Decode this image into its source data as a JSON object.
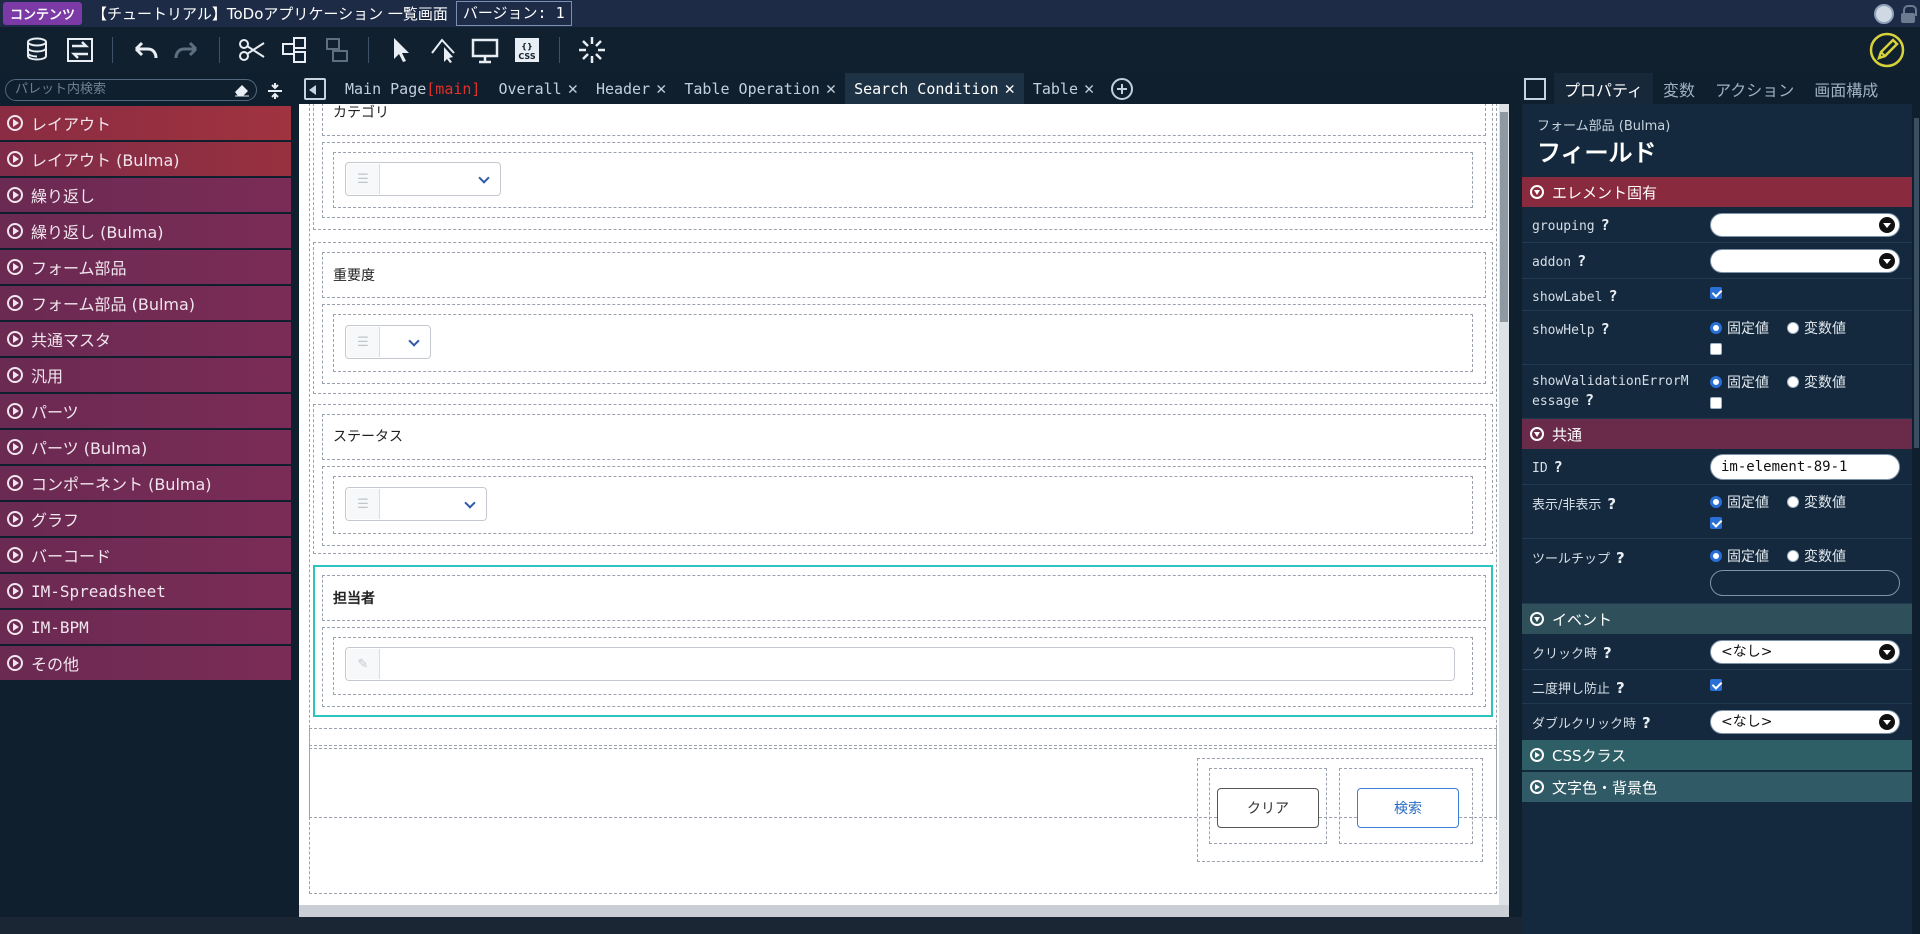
{
  "titlebar": {
    "badge": "コンテンツ",
    "title": "【チュートリアル】ToDoアプリケーション 一覧画面",
    "version": "バージョン: 1"
  },
  "palette": {
    "search_placeholder": "パレット内検索",
    "items": [
      "レイアウト",
      "レイアウト (Bulma)",
      "繰り返し",
      "繰り返し (Bulma)",
      "フォーム部品",
      "フォーム部品 (Bulma)",
      "共通マスタ",
      "汎用",
      "パーツ",
      "パーツ (Bulma)",
      "コンポーネント (Bulma)",
      "グラフ",
      "バーコード",
      "IM-Spreadsheet",
      "IM-BPM",
      "その他"
    ]
  },
  "tabs": {
    "main_label": "Main Page",
    "main_suffix": "[main]",
    "items": [
      "Overall",
      "Header",
      "Table Operation",
      "Search Condition",
      "Table"
    ],
    "active": "Search Condition",
    "close": "✕"
  },
  "canvas": {
    "sections": {
      "category": "カテゴリ",
      "priority": "重要度",
      "status": "ステータス",
      "assignee": "担当者"
    },
    "buttons": {
      "clear": "クリア",
      "search": "検索"
    }
  },
  "properties": {
    "tabs": [
      "プロパティ",
      "変数",
      "アクション",
      "画面構成"
    ],
    "subtitle": "フォーム部品 (Bulma)",
    "title": "フィールド",
    "section_element": "エレメント固有",
    "section_common": "共通",
    "section_event": "イベント",
    "section_css": "CSSクラス",
    "section_color": "文字色・背景色",
    "q": "?",
    "fixed": "固定値",
    "variable": "変数値",
    "rows": {
      "grouping": "grouping",
      "addon": "addon",
      "showLabel": "showLabel",
      "showHelp": "showHelp",
      "showValidation_1": "showValidationErrorM",
      "showValidation_2": "essage",
      "id": "ID",
      "id_value": "im-element-89-1",
      "visible": "表示/非表示",
      "tooltip": "ツールチップ",
      "onclick": "クリック時",
      "onclick_value": "<なし>",
      "double_prevent": "二度押し防止",
      "dblclick": "ダブルクリック時",
      "dblclick_value": "<なし>"
    }
  },
  "colors": {
    "accent_teal": "#2cc3c0",
    "section_red": "#8a2a3f",
    "section_teal": "#2f5f66",
    "tab_active": "#1e3246"
  }
}
